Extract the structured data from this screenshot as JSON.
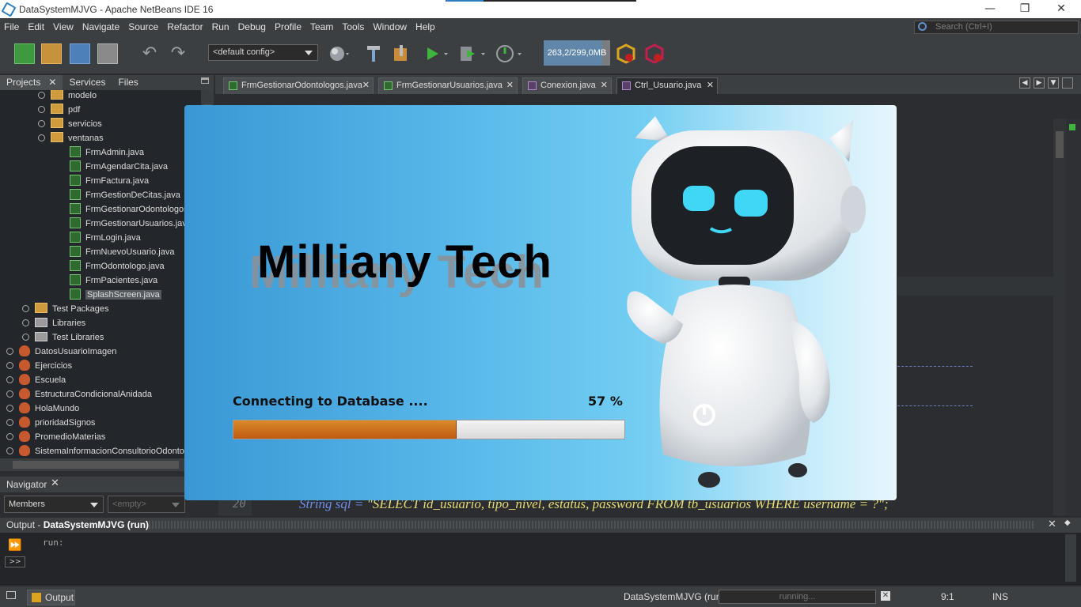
{
  "window": {
    "title": "DataSystemMJVG - Apache NetBeans IDE 16",
    "minimize": "—",
    "restore": "❐",
    "close": "✕"
  },
  "menu": [
    "File",
    "Edit",
    "View",
    "Navigate",
    "Source",
    "Refactor",
    "Run",
    "Debug",
    "Profile",
    "Team",
    "Tools",
    "Window",
    "Help"
  ],
  "search": {
    "placeholder": "Search (Ctrl+I)"
  },
  "toolbar": {
    "config_value": "<default config>",
    "memory_label": "263,2/299,0MB",
    "memory_used_fraction": 0.88,
    "icons": [
      "new-file-icon",
      "new-project-icon",
      "open-project-icon",
      "close-project-icon",
      "undo-icon",
      "redo-icon",
      "config-dropdown",
      "browser-icon",
      "build-icon",
      "clean-build-icon",
      "run-icon",
      "debug-icon",
      "profile-icon",
      "gc-icon",
      "cancel-gc-icon"
    ]
  },
  "projects_panel": {
    "tabs": [
      "Projects",
      "Services",
      "Files"
    ],
    "tree": [
      {
        "label": "modelo",
        "icon": "folder-icon",
        "level": 1
      },
      {
        "label": "pdf",
        "icon": "folder-icon",
        "level": 1
      },
      {
        "label": "servicios",
        "icon": "folder-icon",
        "level": 1
      },
      {
        "label": "ventanas",
        "icon": "folder-icon",
        "level": 1
      },
      {
        "label": "FrmAdmin.java",
        "icon": "java-file-icon",
        "level": 2
      },
      {
        "label": "FrmAgendarCita.java",
        "icon": "java-file-icon",
        "level": 2
      },
      {
        "label": "FrmFactura.java",
        "icon": "java-file-icon",
        "level": 2
      },
      {
        "label": "FrmGestionDeCitas.java",
        "icon": "java-file-icon",
        "level": 2
      },
      {
        "label": "FrmGestionarOdontologos",
        "icon": "java-file-icon",
        "level": 2
      },
      {
        "label": "FrmGestionarUsuarios.jav",
        "icon": "java-file-icon",
        "level": 2
      },
      {
        "label": "FrmLogin.java",
        "icon": "java-file-icon",
        "level": 2
      },
      {
        "label": "FrmNuevoUsuario.java",
        "icon": "java-file-icon",
        "level": 2
      },
      {
        "label": "FrmOdontologo.java",
        "icon": "java-file-icon",
        "level": 2
      },
      {
        "label": "FrmPacientes.java",
        "icon": "java-file-icon",
        "level": 2
      },
      {
        "label": "SplashScreen.java",
        "icon": "java-file-icon",
        "level": 2,
        "selected": true
      },
      {
        "label": "Test Packages",
        "icon": "folder-icon",
        "level": 0
      },
      {
        "label": "Libraries",
        "icon": "library-icon",
        "level": 0
      },
      {
        "label": "Test Libraries",
        "icon": "library-icon",
        "level": 0
      },
      {
        "label": "DatosUsuarioImagen",
        "icon": "coffee-project-icon",
        "level": -1
      },
      {
        "label": "Ejercicios",
        "icon": "coffee-project-icon",
        "level": -1
      },
      {
        "label": "Escuela",
        "icon": "coffee-project-icon",
        "level": -1
      },
      {
        "label": "EstructuraCondicionalAnidada",
        "icon": "coffee-project-icon",
        "level": -1
      },
      {
        "label": "HolaMundo",
        "icon": "coffee-project-icon",
        "level": -1
      },
      {
        "label": "prioridadSignos",
        "icon": "coffee-project-icon",
        "level": -1
      },
      {
        "label": "PromedioMaterias",
        "icon": "coffee-project-icon",
        "level": -1
      },
      {
        "label": "SistemaInformacionConsultorioOdonto",
        "icon": "coffee-project-icon",
        "level": -1
      }
    ]
  },
  "navigator": {
    "title": "Navigator",
    "filter_value": "Members",
    "secondary_value": "<empty>"
  },
  "editor": {
    "tabs": [
      "FrmGestionarOdontologos.java",
      "FrmGestionarUsuarios.java",
      "Conexion.java",
      "Ctrl_Usuario.java"
    ],
    "active_tab": "Ctrl_Usuario.java",
    "visible_line_number": "20",
    "visible_code_prefix": "String sql = ",
    "visible_code_string": "\"SELECT id_usuario, tipo_nivel, estatus, password FROM tb_usuarios WHERE username = ?\";"
  },
  "splash": {
    "brand": "Milliany Tech",
    "status_text": "Connecting to Database ....",
    "percent_text": "57 %",
    "progress_fraction": 0.57
  },
  "output": {
    "title_prefix": "Output - ",
    "title_project": "DataSystemMJVG (run)",
    "log_text": "run:"
  },
  "statusbar": {
    "output_button": "Output",
    "run_label": "DataSystemMJVG (run)",
    "progress_text": "running...",
    "cursor_pos": "9:1",
    "insert_mode": "INS"
  }
}
